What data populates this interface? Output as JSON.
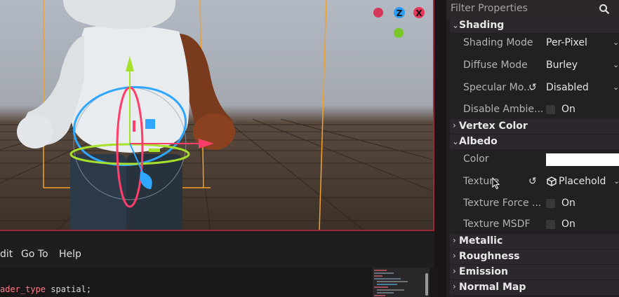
{
  "viewport": {
    "gizmo_axes": [
      "Z",
      "X"
    ]
  },
  "editor": {
    "menu": [
      "dit",
      "Go To",
      "Help"
    ],
    "code_keyword": "ader_type",
    "code_rest": " spatial;"
  },
  "inspector": {
    "filter_placeholder": "Filter Properties",
    "sections": {
      "shading": "Shading",
      "vertex_color": "Vertex Color",
      "albedo": "Albedo",
      "metallic": "Metallic",
      "roughness": "Roughness",
      "emission": "Emission",
      "normal_map": "Normal Map"
    },
    "shading": {
      "shading_mode_label": "Shading Mode",
      "shading_mode_value": "Per-Pixel",
      "diffuse_mode_label": "Diffuse Mode",
      "diffuse_mode_value": "Burley",
      "specular_mode_label": "Specular Mo...",
      "specular_mode_value": "Disabled",
      "disable_ambient_label": "Disable Ambie...",
      "disable_ambient_value": "On"
    },
    "albedo": {
      "color_label": "Color",
      "color_value": "#ffffff",
      "texture_label": "Texture",
      "texture_value": "Placehold",
      "texture_force_label": "Texture Force ...",
      "texture_force_value": "On",
      "texture_msdf_label": "Texture MSDF",
      "texture_msdf_value": "On"
    }
  }
}
